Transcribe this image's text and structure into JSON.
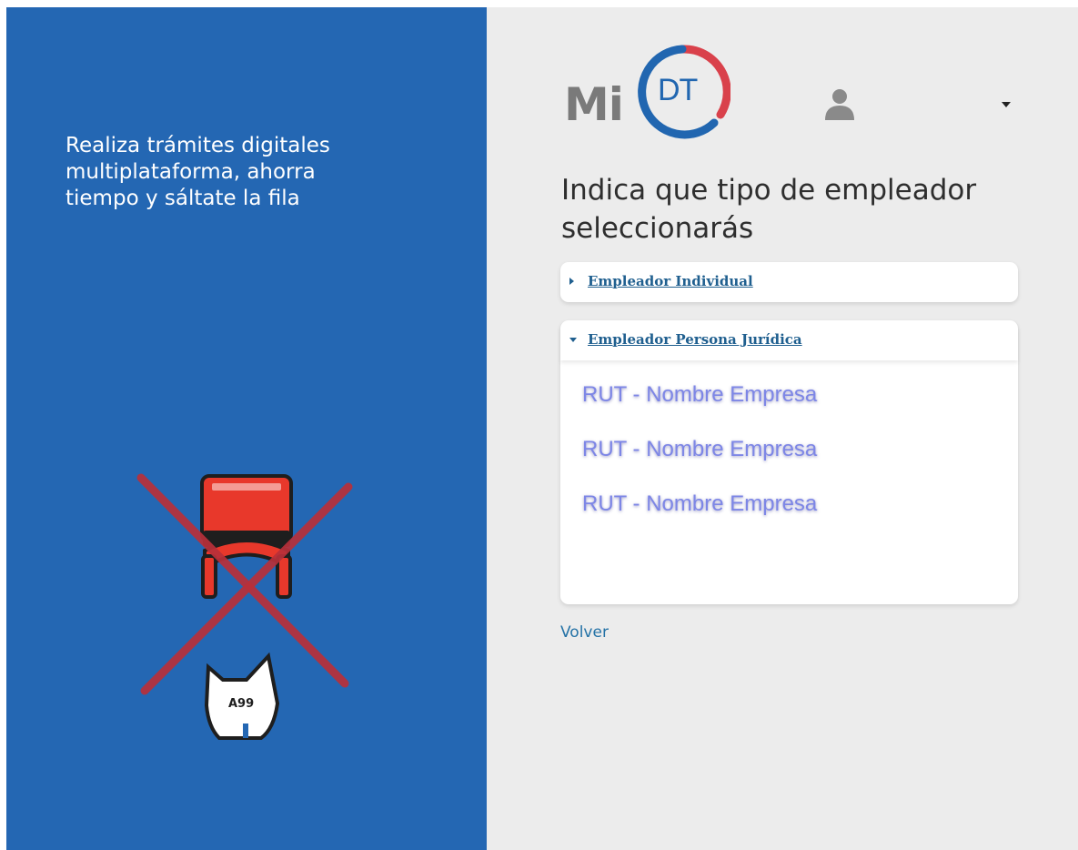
{
  "left": {
    "tagline": "Realiza trámites digitales\nmultiplataforma, ahorra\ntiempo y sáltate la fila",
    "illustration": {
      "ticket_label": "A99",
      "icon": "no-queue-chair-ticket-icon"
    }
  },
  "header": {
    "logo_mi": "Mi",
    "logo_dt": "DT",
    "user_icon": "user-icon",
    "menu_icon": "caret-down-icon"
  },
  "main": {
    "title": "Indica que tipo de empleador seleccionarás",
    "options": [
      {
        "label": "Empleador Individual",
        "expanded": false
      },
      {
        "label": "Empleador Persona Jurídica",
        "expanded": true
      }
    ],
    "companies": [
      "RUT - Nombre Empresa",
      "RUT - Nombre Empresa",
      "RUT - Nombre Empresa"
    ],
    "back_label": "Volver"
  },
  "colors": {
    "left_bg": "#2467b3",
    "right_bg": "#ececec",
    "link": "#1f5f8f",
    "company_text": "#7d86e6",
    "logo_blue": "#2166b0",
    "logo_red": "#d9414b"
  }
}
